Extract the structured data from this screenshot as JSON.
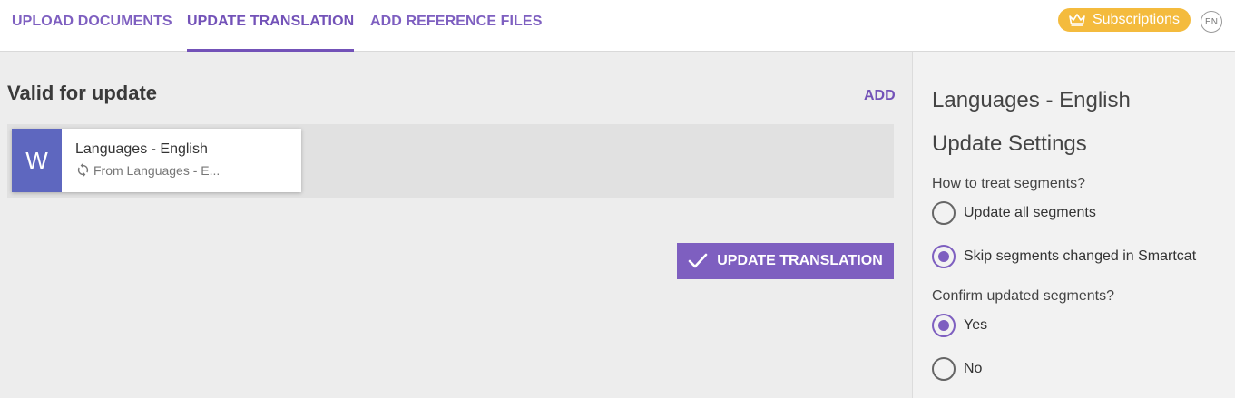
{
  "tabs": [
    {
      "label": "UPLOAD DOCUMENTS",
      "active": false
    },
    {
      "label": "UPDATE TRANSLATION",
      "active": true
    },
    {
      "label": "ADD REFERENCE FILES",
      "active": false
    }
  ],
  "header": {
    "subscriptions_label": "Subscriptions",
    "language_code": "EN"
  },
  "main": {
    "section_title": "Valid for update",
    "add_label": "ADD",
    "document": {
      "icon_letter": "W",
      "name": "Languages - English",
      "source": "From Languages - E..."
    },
    "update_button_label": "UPDATE TRANSLATION"
  },
  "settings": {
    "title": "Languages - English",
    "subtitle": "Update Settings",
    "segments_question": "How to treat segments?",
    "segments_options": [
      {
        "label": "Update all segments",
        "checked": false
      },
      {
        "label": "Skip segments changed in Smartcat",
        "checked": true
      }
    ],
    "confirm_question": "Confirm updated segments?",
    "confirm_options": [
      {
        "label": "Yes",
        "checked": true
      },
      {
        "label": "No",
        "checked": false
      }
    ]
  },
  "colors": {
    "accent": "#7e5fc0",
    "subscriptions": "#f4bb3d",
    "doc_icon": "#5e67bf"
  }
}
